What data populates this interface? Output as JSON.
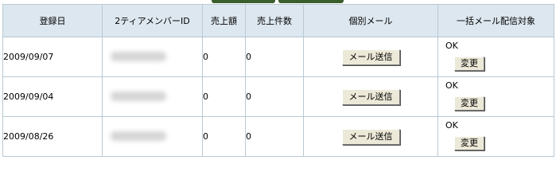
{
  "table": {
    "headers": [
      "登録日",
      "2ティアメンバーID",
      "売上額",
      "売上件数",
      "個別メール",
      "一括メール配信対象"
    ],
    "rows": [
      {
        "date": "2009/09/07",
        "sales_amount": "0",
        "sales_count": "0",
        "mail_button": "メール送信",
        "bulk_status": "OK",
        "change_button": "変更"
      },
      {
        "date": "2009/09/04",
        "sales_amount": "0",
        "sales_count": "0",
        "mail_button": "メール送信",
        "bulk_status": "OK",
        "change_button": "変更"
      },
      {
        "date": "2009/08/26",
        "sales_amount": "0",
        "sales_count": "0",
        "mail_button": "メール送信",
        "bulk_status": "OK",
        "change_button": "変更"
      }
    ]
  },
  "colors": {
    "header_bg": "#dde7ef",
    "border": "#b9c9d3",
    "tab_accent": "#3a5f2c",
    "button_bg": "#ece9d8"
  }
}
